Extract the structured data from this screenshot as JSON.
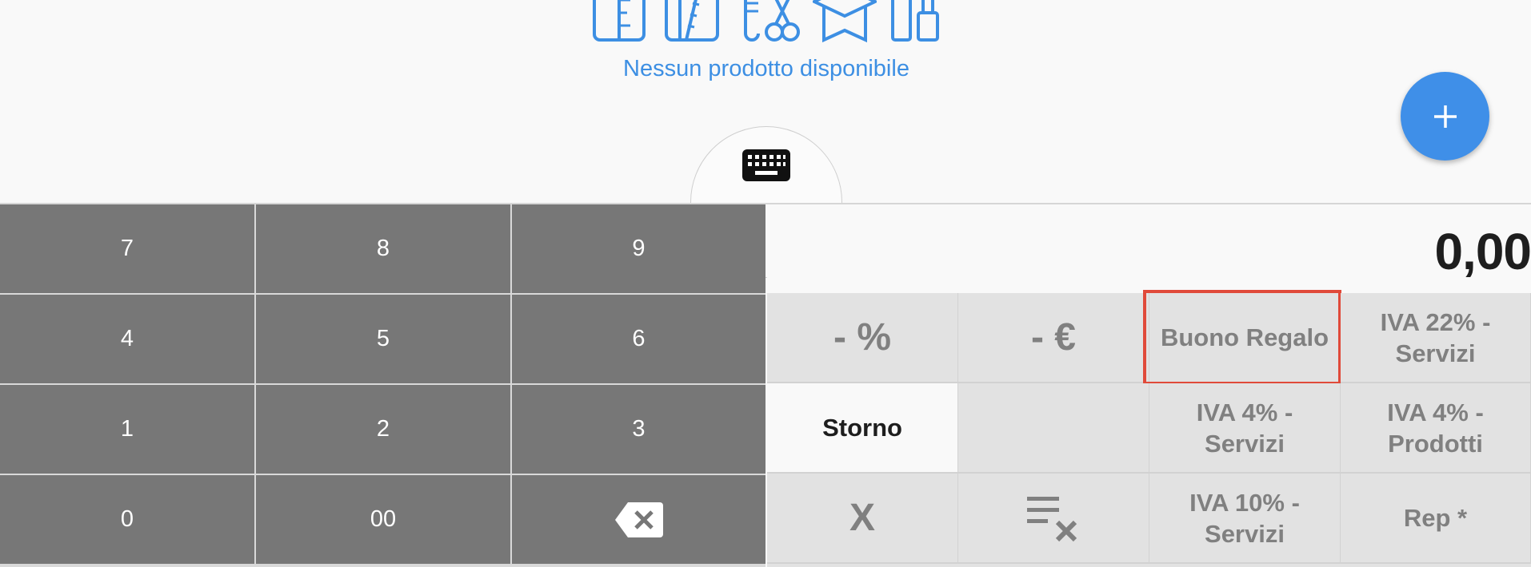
{
  "empty_state": {
    "message": "Nessun prodotto disponibile",
    "category_icons": [
      "ruler-icon",
      "measuring-tape-icon",
      "comb-scissors-icon",
      "graduation-cap-icon",
      "lipstick-icon"
    ]
  },
  "fab": {
    "label": "+",
    "icon": "plus-icon"
  },
  "keyboard_toggle": {
    "icon": "keyboard-icon"
  },
  "numpad": {
    "keys": [
      "7",
      "8",
      "9",
      "4",
      "5",
      "6",
      "1",
      "2",
      "3",
      "0",
      "00"
    ],
    "backspace_icon": "backspace-icon"
  },
  "display": {
    "value": "0,00"
  },
  "function_keys": {
    "discount_percent": "- %",
    "discount_euro": "- €",
    "gift_voucher": "Buono Regalo",
    "iva22_servizi": "IVA 22% -\nServizi",
    "storno": "Storno",
    "iva4_servizi": "IVA 4% -\nServizi",
    "iva4_prodotti": "IVA 4% -\nProdotti",
    "cancel": "X",
    "clear_list_icon": "clear-list-icon",
    "iva10_servizi": "IVA 10% -\nServizi",
    "rep": "Rep *"
  },
  "colors": {
    "accent": "#3f8fe8",
    "numpad_key": "#777777",
    "function_key": "#e2e2e2",
    "highlight": "#e04a3a"
  }
}
